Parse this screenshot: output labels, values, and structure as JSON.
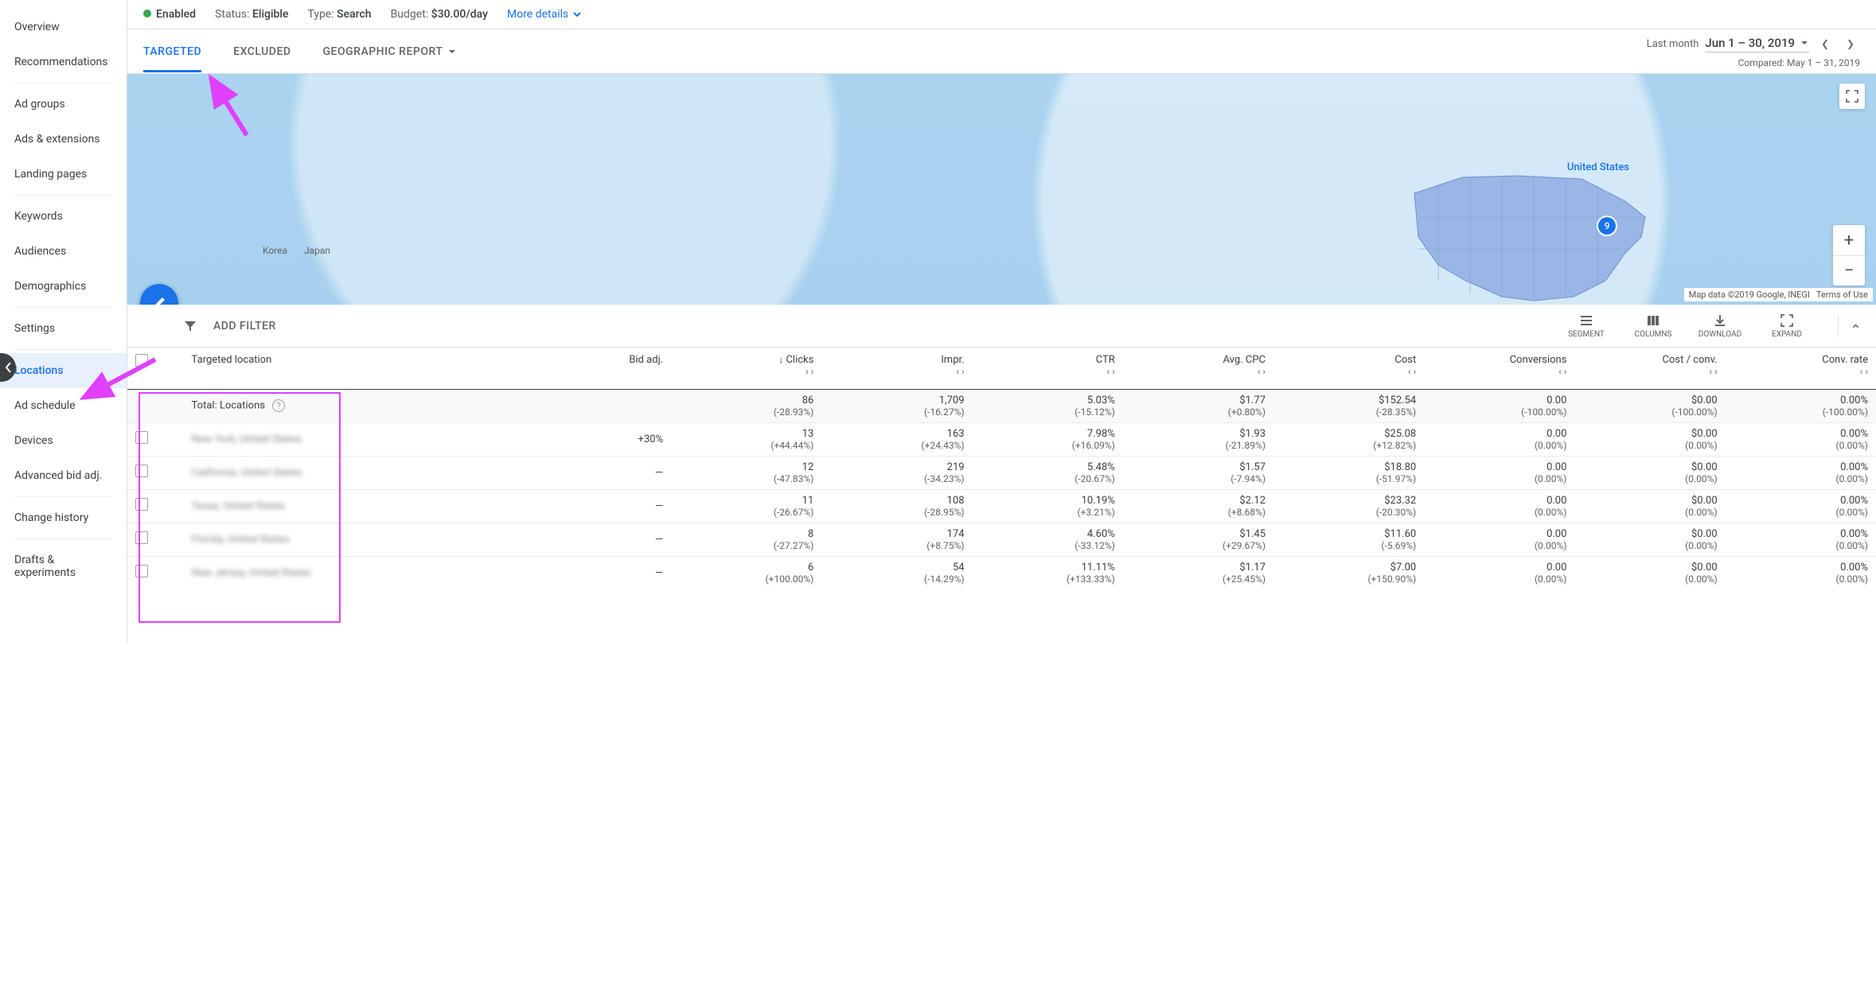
{
  "sidebar": {
    "items": [
      {
        "label": "Overview"
      },
      {
        "label": "Recommendations"
      },
      {
        "label": "Ad groups"
      },
      {
        "label": "Ads & extensions"
      },
      {
        "label": "Landing pages"
      },
      {
        "label": "Keywords"
      },
      {
        "label": "Audiences"
      },
      {
        "label": "Demographics"
      },
      {
        "label": "Settings"
      },
      {
        "label": "Locations"
      },
      {
        "label": "Ad schedule"
      },
      {
        "label": "Devices"
      },
      {
        "label": "Advanced bid adj."
      },
      {
        "label": "Change history"
      },
      {
        "label": "Drafts & experiments"
      }
    ],
    "active_index": 9
  },
  "status": {
    "enabled_label": "Enabled",
    "status_label": "Status:",
    "status_value": "Eligible",
    "type_label": "Type:",
    "type_value": "Search",
    "budget_label": "Budget:",
    "budget_value": "$30.00/day",
    "more_details": "More details"
  },
  "tabs": {
    "targeted": "TARGETED",
    "excluded": "EXCLUDED",
    "geo": "GEOGRAPHIC REPORT"
  },
  "date": {
    "last_month": "Last month",
    "range": "Jun 1 – 30, 2019",
    "compared": "Compared: May 1 – 31, 2019"
  },
  "map": {
    "label": "United States",
    "bubble": "9",
    "attrib": "Map data ©2019 Google, INEGI",
    "terms": "Terms of Use",
    "places": [
      "Korea",
      "Japan"
    ]
  },
  "toolbar": {
    "add_filter": "ADD FILTER",
    "segment": "SEGMENT",
    "columns": "COLUMNS",
    "download": "DOWNLOAD",
    "expand": "EXPAND"
  },
  "table": {
    "headers": {
      "location": "Targeted location",
      "bid": "Bid adj.",
      "clicks": "Clicks",
      "impr": "Impr.",
      "ctr": "CTR",
      "cpc": "Avg. CPC",
      "cost": "Cost",
      "conv": "Conversions",
      "cost_conv": "Cost / conv.",
      "conv_rate": "Conv. rate"
    },
    "total_label": "Total: Locations",
    "total": {
      "clicks": {
        "v": "86",
        "d": "(-28.93%)"
      },
      "impr": {
        "v": "1,709",
        "d": "(-16.27%)"
      },
      "ctr": {
        "v": "5.03%",
        "d": "(-15.12%)"
      },
      "cpc": {
        "v": "$1.77",
        "d": "(+0.80%)"
      },
      "cost": {
        "v": "$152.54",
        "d": "(-28.35%)"
      },
      "conv": {
        "v": "0.00",
        "d": "(-100.00%)"
      },
      "cost_conv": {
        "v": "$0.00",
        "d": "(-100.00%)"
      },
      "conv_rate": {
        "v": "0.00%",
        "d": "(-100.00%)"
      }
    },
    "rows": [
      {
        "loc": "New York, United States",
        "bid": "+30%",
        "clicks": {
          "v": "13",
          "d": "(+44.44%)"
        },
        "impr": {
          "v": "163",
          "d": "(+24.43%)"
        },
        "ctr": {
          "v": "7.98%",
          "d": "(+16.09%)"
        },
        "cpc": {
          "v": "$1.93",
          "d": "(-21.89%)"
        },
        "cost": {
          "v": "$25.08",
          "d": "(+12.82%)"
        },
        "conv": {
          "v": "0.00",
          "d": "(0.00%)"
        },
        "cost_conv": {
          "v": "$0.00",
          "d": "(0.00%)"
        },
        "conv_rate": {
          "v": "0.00%",
          "d": "(0.00%)"
        }
      },
      {
        "loc": "California, United States",
        "bid": "—",
        "clicks": {
          "v": "12",
          "d": "(-47.83%)"
        },
        "impr": {
          "v": "219",
          "d": "(-34.23%)"
        },
        "ctr": {
          "v": "5.48%",
          "d": "(-20.67%)"
        },
        "cpc": {
          "v": "$1.57",
          "d": "(-7.94%)"
        },
        "cost": {
          "v": "$18.80",
          "d": "(-51.97%)"
        },
        "conv": {
          "v": "0.00",
          "d": "(0.00%)"
        },
        "cost_conv": {
          "v": "$0.00",
          "d": "(0.00%)"
        },
        "conv_rate": {
          "v": "0.00%",
          "d": "(0.00%)"
        }
      },
      {
        "loc": "Texas, United States",
        "bid": "—",
        "clicks": {
          "v": "11",
          "d": "(-26.67%)"
        },
        "impr": {
          "v": "108",
          "d": "(-28.95%)"
        },
        "ctr": {
          "v": "10.19%",
          "d": "(+3.21%)"
        },
        "cpc": {
          "v": "$2.12",
          "d": "(+8.68%)"
        },
        "cost": {
          "v": "$23.32",
          "d": "(-20.30%)"
        },
        "conv": {
          "v": "0.00",
          "d": "(0.00%)"
        },
        "cost_conv": {
          "v": "$0.00",
          "d": "(0.00%)"
        },
        "conv_rate": {
          "v": "0.00%",
          "d": "(0.00%)"
        }
      },
      {
        "loc": "Florida, United States",
        "bid": "—",
        "clicks": {
          "v": "8",
          "d": "(-27.27%)"
        },
        "impr": {
          "v": "174",
          "d": "(+8.75%)"
        },
        "ctr": {
          "v": "4.60%",
          "d": "(-33.12%)"
        },
        "cpc": {
          "v": "$1.45",
          "d": "(+29.67%)"
        },
        "cost": {
          "v": "$11.60",
          "d": "(-5.69%)"
        },
        "conv": {
          "v": "0.00",
          "d": "(0.00%)"
        },
        "cost_conv": {
          "v": "$0.00",
          "d": "(0.00%)"
        },
        "conv_rate": {
          "v": "0.00%",
          "d": "(0.00%)"
        }
      },
      {
        "loc": "New Jersey, United States",
        "bid": "—",
        "clicks": {
          "v": "6",
          "d": "(+100.00%)"
        },
        "impr": {
          "v": "54",
          "d": "(-14.29%)"
        },
        "ctr": {
          "v": "11.11%",
          "d": "(+133.33%)"
        },
        "cpc": {
          "v": "$1.17",
          "d": "(+25.45%)"
        },
        "cost": {
          "v": "$7.00",
          "d": "(+150.90%)"
        },
        "conv": {
          "v": "0.00",
          "d": "(0.00%)"
        },
        "cost_conv": {
          "v": "$0.00",
          "d": "(0.00%)"
        },
        "conv_rate": {
          "v": "0.00%",
          "d": "(0.00%)"
        }
      }
    ]
  }
}
